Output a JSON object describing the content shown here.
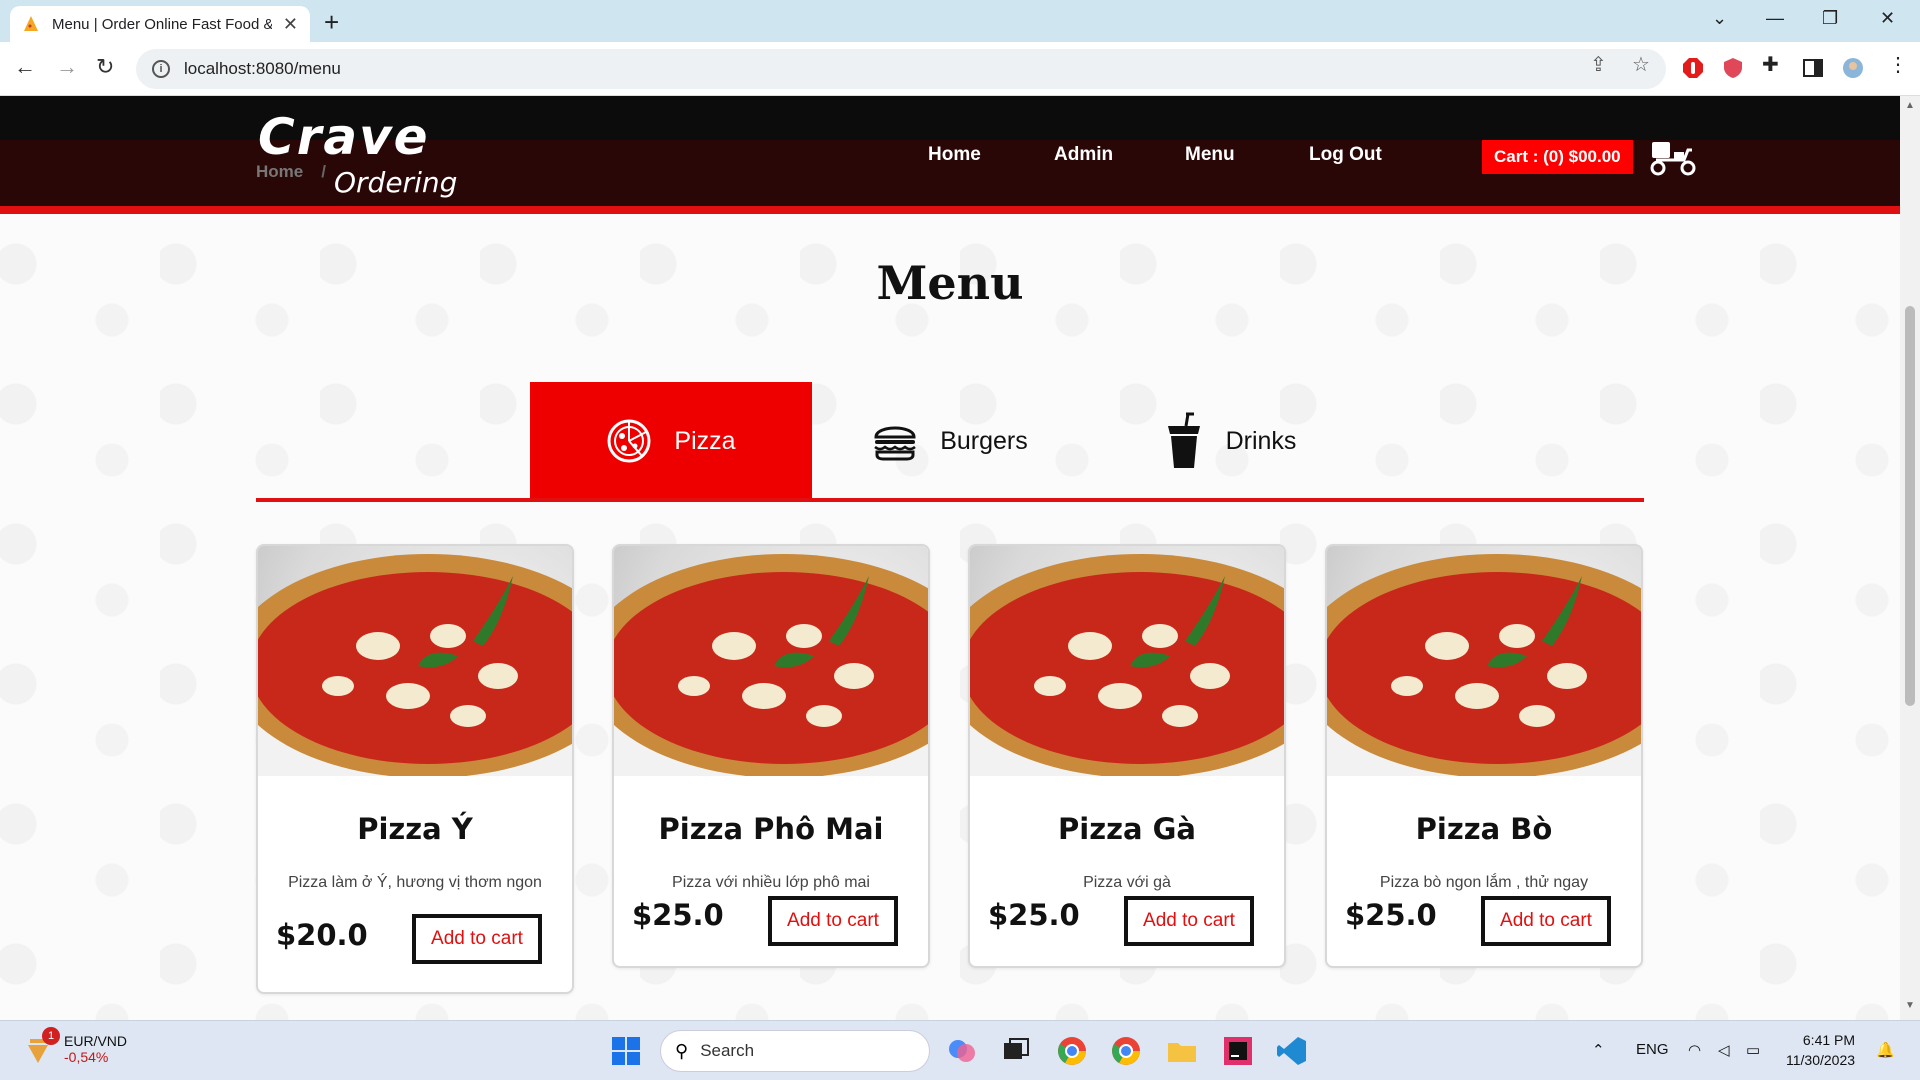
{
  "browser": {
    "tab_title": "Menu | Order Online Fast Food &",
    "url": "localhost:8080/menu"
  },
  "site": {
    "logo_top": "Crave",
    "logo_bottom": "Ordering",
    "breadcrumb": [
      "Home",
      "/"
    ],
    "nav": [
      "Home",
      "Admin",
      "Menu",
      "Log Out"
    ],
    "cart_label": "Cart : (0) $00.00"
  },
  "menu": {
    "title": "Menu",
    "categories": [
      {
        "label": "Pizza",
        "icon": "pizza-icon",
        "active": true
      },
      {
        "label": "Burgers",
        "icon": "burger-icon",
        "active": false
      },
      {
        "label": "Drinks",
        "icon": "drink-icon",
        "active": false
      }
    ],
    "items": [
      {
        "name": "Pizza Ý",
        "desc": "Pizza làm ở Ý, hương vị thơm ngon",
        "price": "$20.0",
        "button": "Add to cart"
      },
      {
        "name": "Pizza Phô Mai",
        "desc": "Pizza với nhiều lớp phô mai",
        "price": "$25.0",
        "button": "Add to cart"
      },
      {
        "name": "Pizza Gà",
        "desc": "Pizza với gà",
        "price": "$25.0",
        "button": "Add to cart"
      },
      {
        "name": "Pizza Bò",
        "desc": "Pizza bò ngon lắm , thử ngay",
        "price": "$25.0",
        "button": "Add to cart"
      }
    ]
  },
  "taskbar": {
    "ticker_name": "EUR/VND",
    "ticker_value": "-0,54%",
    "ticker_badge": "1",
    "search_label": "Search",
    "language": "ENG",
    "time": "6:41 PM",
    "date": "11/30/2023"
  },
  "colors": {
    "accent": "#ee0000",
    "header_dark": "#2a0707"
  }
}
